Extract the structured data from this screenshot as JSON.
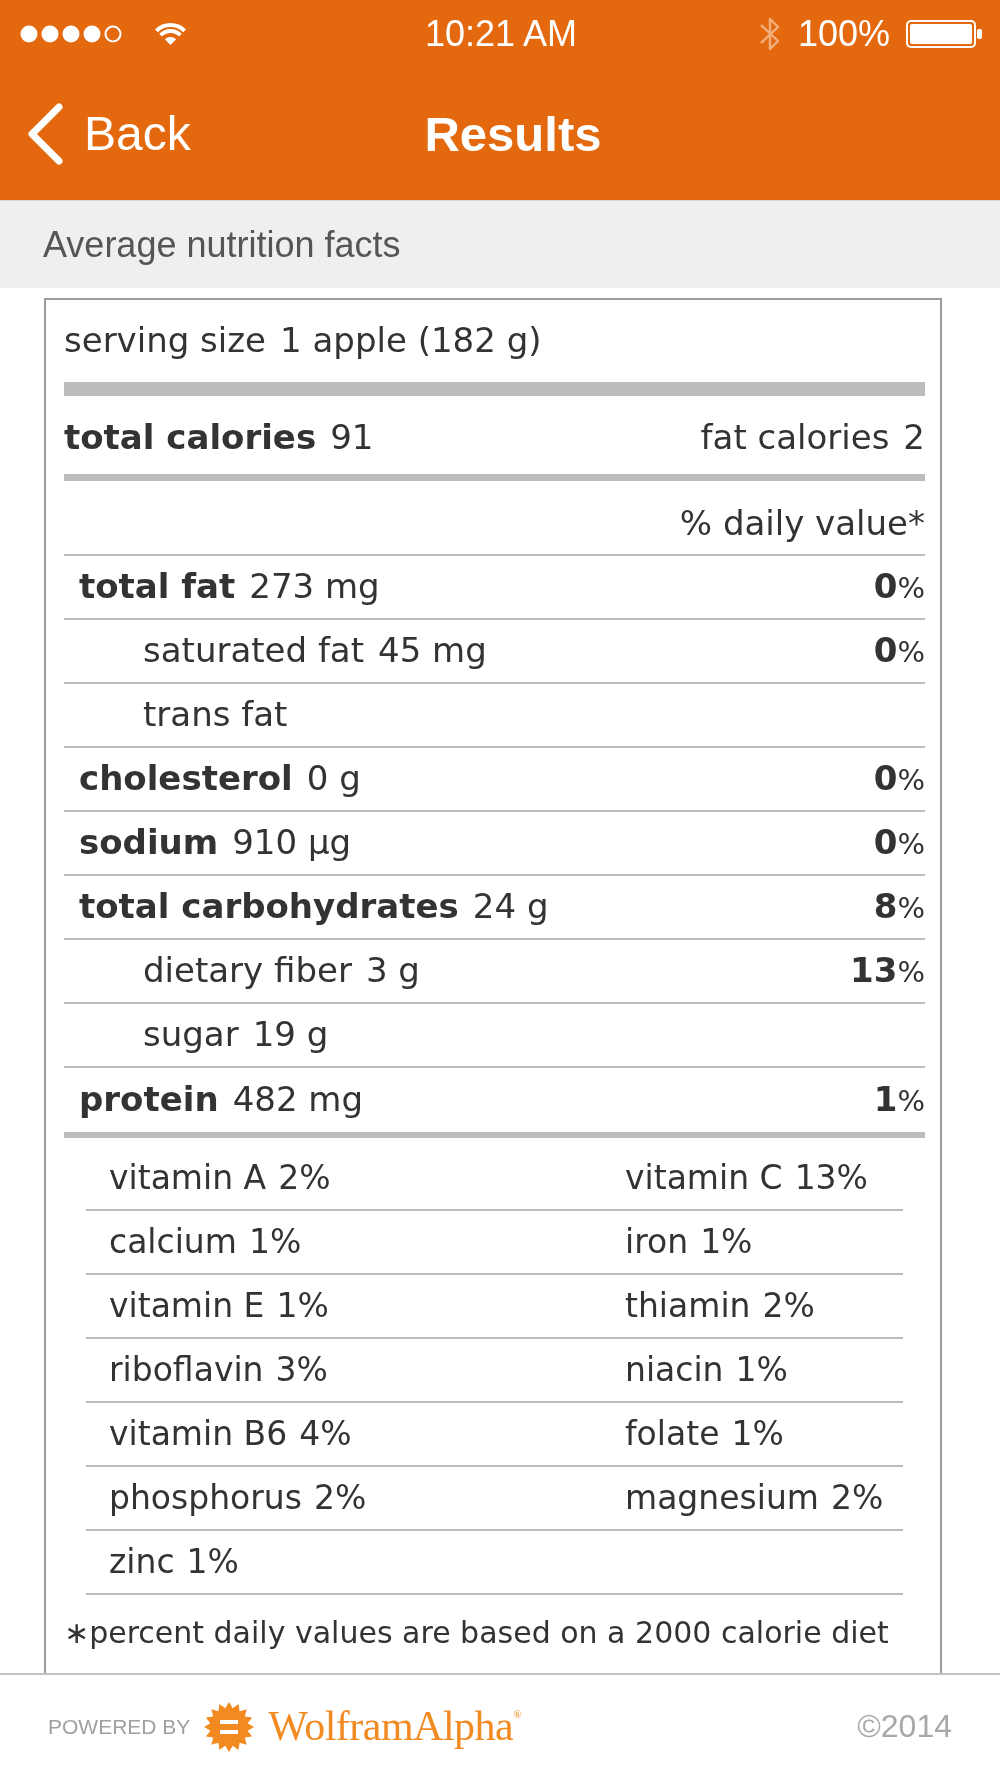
{
  "status_bar": {
    "time": "10:21 AM",
    "battery": "100%"
  },
  "nav_bar": {
    "back": "Back",
    "title": "Results"
  },
  "section": {
    "title": "Average nutrition facts"
  },
  "label": {
    "serving": {
      "label": "serving size",
      "value": "1 apple (182 g)"
    },
    "calories": {
      "label": "total calories",
      "value": "91",
      "fat_label": "fat calories",
      "fat_value": "2"
    },
    "daily_value_header": "% daily value*",
    "nutrients": [
      {
        "kind": "main",
        "name": "total fat",
        "amount": "273 mg",
        "daily_value": "**0**%"
      },
      {
        "kind": "sub",
        "name": "saturated fat",
        "amount": "45 mg",
        "daily_value": "**0**%"
      },
      {
        "kind": "sub",
        "name": "trans fat"
      },
      {
        "kind": "main",
        "name": "cholesterol",
        "amount": "0 g",
        "daily_value": "**0**%"
      },
      {
        "kind": "main",
        "name": "sodium",
        "amount": "910 µg",
        "daily_value": "**0**%"
      },
      {
        "kind": "main",
        "name": "total carbohydrates",
        "amount": "24 g",
        "daily_value": "**8**%"
      },
      {
        "kind": "sub",
        "name": "dietary fiber",
        "amount": "3 g",
        "daily_value": "**13**%"
      },
      {
        "kind": "sub",
        "name": "sugar",
        "amount": "19 g"
      },
      {
        "kind": "main",
        "name": "protein",
        "amount": "482 mg",
        "daily_value": "**1**%"
      }
    ],
    "vitamins": [
      {
        "name": "vitamin A",
        "value": "2%"
      },
      {
        "name": "vitamin C",
        "value": "13%"
      },
      {
        "name": "calcium",
        "value": "1%"
      },
      {
        "name": "iron",
        "value": "1%"
      },
      {
        "name": "vitamin E",
        "value": "1%"
      },
      {
        "name": "thiamin",
        "value": "2%"
      },
      {
        "name": "riboflavin",
        "value": "3%"
      },
      {
        "name": "niacin",
        "value": "1%"
      },
      {
        "name": "vitamin B6",
        "value": "4%"
      },
      {
        "name": "folate",
        "value": "1%"
      },
      {
        "name": "phosphorus",
        "value": "2%"
      },
      {
        "name": "magnesium",
        "value": "2%"
      },
      {
        "name": "zinc",
        "value": "1%"
      }
    ],
    "footnote": "∗percent daily values are based on a 2000 calorie diet"
  },
  "footer": {
    "powered_by": "POWERED BY",
    "brand": "WolframAlpha$^{®}$",
    "copyright": "©2014"
  }
}
